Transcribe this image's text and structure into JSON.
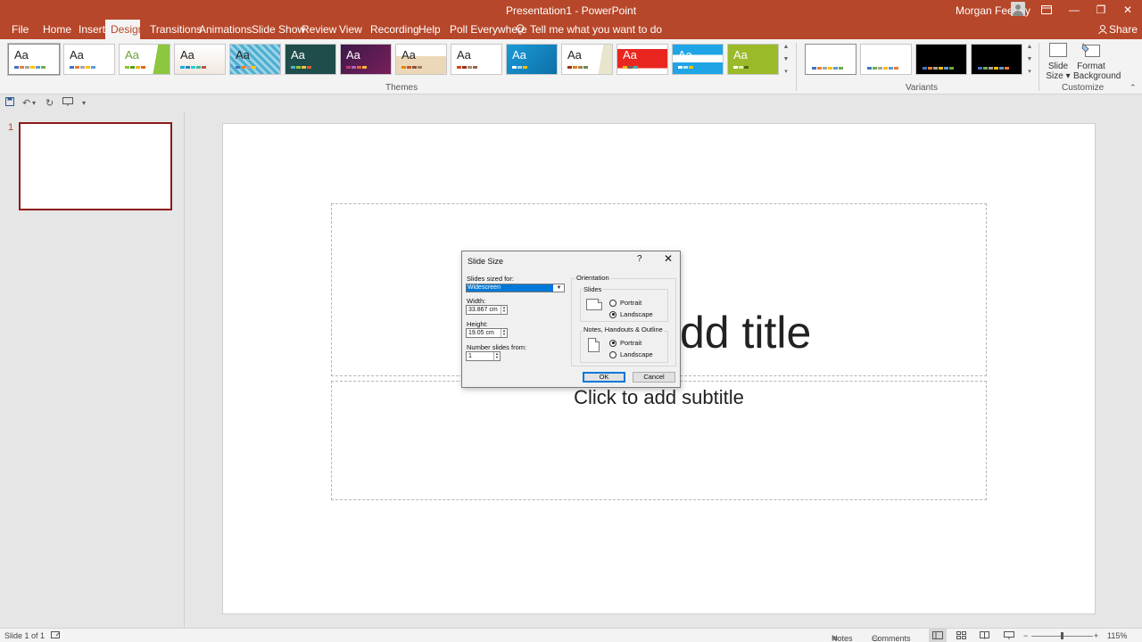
{
  "titlebar": {
    "title": "Presentation1  -  PowerPoint",
    "user": "Morgan Feeney",
    "accent_color": "#b7472a"
  },
  "window_controls": {
    "ribbon_display_icon": "ribbon-display-icon",
    "minimize": "—",
    "restore": "❐",
    "close": "✕"
  },
  "tabs": [
    "File",
    "Home",
    "Insert",
    "Design",
    "Transitions",
    "Animations",
    "Slide Show",
    "Review",
    "View",
    "Recording",
    "Help",
    "Poll Everywhere"
  ],
  "active_tab": "Design",
  "tell_me": "Tell me what you want to do",
  "share": "Share",
  "ribbon": {
    "themes_label": "Themes",
    "variants_label": "Variants",
    "customize_label": "Customize",
    "theme_sample": "Aa",
    "slide_size_line1": "Slide",
    "slide_size_line2": "Size",
    "format_background_line1": "Format",
    "format_background_line2": "Background"
  },
  "thumbnail_pane": {
    "slide_number": "1"
  },
  "slide": {
    "title_placeholder": "dd title",
    "subtitle_placeholder": "Click to add subtitle"
  },
  "dialog": {
    "title": "Slide Size",
    "help": "?",
    "close": "✕",
    "sized_for_label": "Slides sized for:",
    "sized_for_value": "Widescreen",
    "width_label": "Width:",
    "width_value": "33.867 cm",
    "height_label": "Height:",
    "height_value": "19.05 cm",
    "number_from_label": "Number slides from:",
    "number_from_value": "1",
    "orientation_label": "Orientation",
    "slides_label": "Slides",
    "slides_portrait": "Portrait",
    "slides_landscape": "Landscape",
    "slides_selected": "Landscape",
    "notes_label": "Notes, Handouts & Outline",
    "notes_portrait": "Portrait",
    "notes_landscape": "Landscape",
    "notes_selected": "Portrait",
    "ok": "OK",
    "cancel": "Cancel"
  },
  "status": {
    "slide_count": "Slide 1 of 1",
    "notes": "Notes",
    "comments": "Comments",
    "zoom": "115%"
  }
}
